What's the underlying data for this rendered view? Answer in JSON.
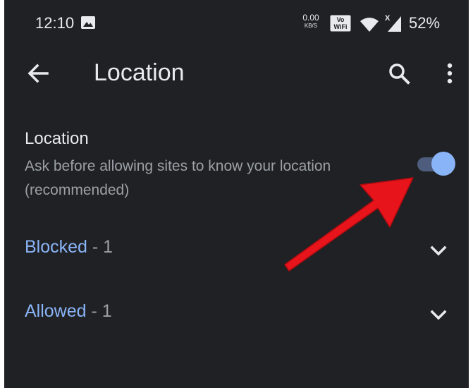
{
  "status_bar": {
    "time": "12:10",
    "speed_value": "0.00",
    "speed_unit": "KB/S",
    "vowifi_top": "Vo",
    "vowifi_bottom": "WiFi",
    "signal_mark": "X",
    "battery": "52%"
  },
  "toolbar": {
    "back_icon": "arrow-back-icon",
    "title": "Location",
    "search_icon": "search-icon",
    "more_icon": "more-vert-icon"
  },
  "location_setting": {
    "title": "Location",
    "description": "Ask before allowing sites to know your location (recommended)",
    "enabled": true
  },
  "sections": {
    "blocked": {
      "label": "Blocked",
      "count": " - 1"
    },
    "allowed": {
      "label": "Allowed",
      "count": " - 1"
    }
  },
  "colors": {
    "background": "#202124",
    "text_primary": "#e8eaed",
    "text_secondary": "#9aa0a6",
    "accent": "#8ab4f8",
    "annotation_arrow": "#e8141b"
  }
}
